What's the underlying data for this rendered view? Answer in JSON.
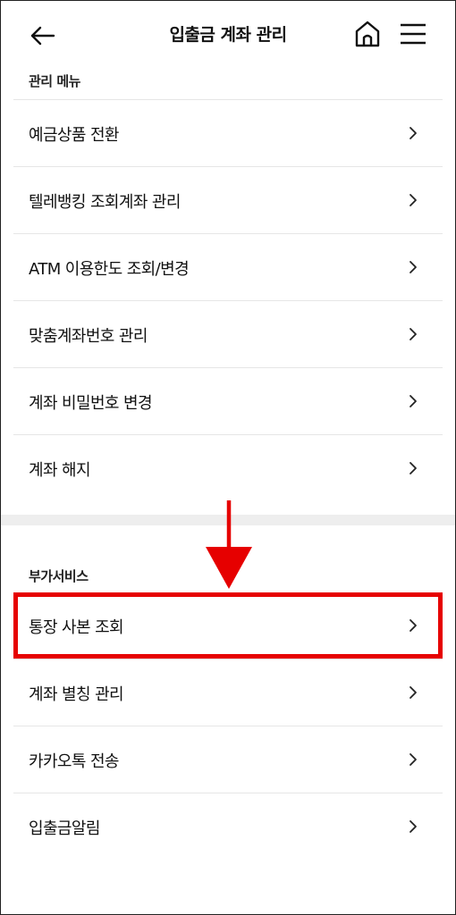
{
  "header": {
    "title": "입출금 계좌 관리",
    "icons": [
      "back-arrow-icon",
      "home-icon",
      "hamburger-menu-icon"
    ]
  },
  "management_menu": {
    "label": "관리 메뉴",
    "items": [
      {
        "label": "예금상품 전환"
      },
      {
        "label": "텔레뱅킹 조회계좌 관리"
      },
      {
        "label": "ATM 이용한도 조회/변경"
      },
      {
        "label": "맞춤계좌번호 관리"
      },
      {
        "label": "계좌 비밀번호 변경"
      },
      {
        "label": "계좌 해지"
      }
    ]
  },
  "additional_services": {
    "label": "부가서비스",
    "items": [
      {
        "label": "통장 사본 조회",
        "highlighted": true
      },
      {
        "label": "계좌 별칭 관리"
      },
      {
        "label": "카카오톡 전송"
      },
      {
        "label": "입출금알림"
      }
    ]
  },
  "annotation": {
    "color": "#e60000",
    "type": "down-arrow-and-box"
  },
  "colors": {
    "text": "#111111",
    "divider": "#e6e6e6",
    "band": "#eeeeee"
  }
}
